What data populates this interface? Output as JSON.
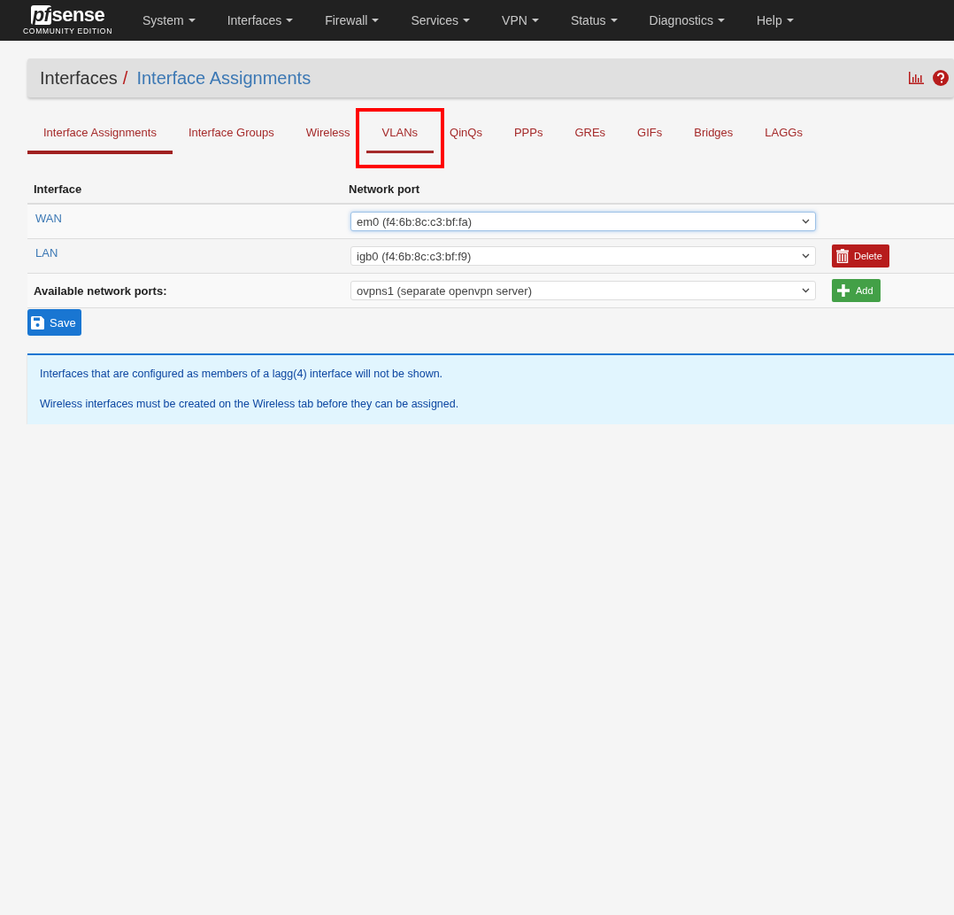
{
  "navbar": {
    "logo": {
      "wordmark_left": "pf",
      "wordmark_right": "sense",
      "edition": "COMMUNITY EDITION"
    },
    "menus": [
      {
        "label": "System"
      },
      {
        "label": "Interfaces"
      },
      {
        "label": "Firewall"
      },
      {
        "label": "Services"
      },
      {
        "label": "VPN"
      },
      {
        "label": "Status"
      },
      {
        "label": "Diagnostics"
      },
      {
        "label": "Help"
      }
    ]
  },
  "breadcrumb": {
    "parent": "Interfaces",
    "separator": "/",
    "current": "Interface Assignments"
  },
  "tabs": [
    {
      "label": "Interface Assignments",
      "selected": true,
      "hovered": false,
      "highlighted": false
    },
    {
      "label": "Interface Groups",
      "selected": false,
      "hovered": false,
      "highlighted": false
    },
    {
      "label": "Wireless",
      "selected": false,
      "hovered": false,
      "highlighted": false
    },
    {
      "label": "VLANs",
      "selected": false,
      "hovered": true,
      "highlighted": true
    },
    {
      "label": "QinQs",
      "selected": false,
      "hovered": false,
      "highlighted": false
    },
    {
      "label": "PPPs",
      "selected": false,
      "hovered": false,
      "highlighted": false
    },
    {
      "label": "GREs",
      "selected": false,
      "hovered": false,
      "highlighted": false
    },
    {
      "label": "GIFs",
      "selected": false,
      "hovered": false,
      "highlighted": false
    },
    {
      "label": "Bridges",
      "selected": false,
      "hovered": false,
      "highlighted": false
    },
    {
      "label": "LAGGs",
      "selected": false,
      "hovered": false,
      "highlighted": false
    }
  ],
  "table": {
    "columns": [
      "Interface",
      "Network port"
    ],
    "rows": [
      {
        "kind": "assigned",
        "interface": "WAN",
        "port": "em0 (f4:6b:8c:c3:bf:fa)",
        "focused": true
      },
      {
        "kind": "assigned",
        "interface": "LAN",
        "port": "igb0 (f4:6b:8c:c3:bf:f9)",
        "focused": false,
        "action": "Delete"
      },
      {
        "kind": "available",
        "interface": "Available network ports:",
        "port": "ovpns1 (separate openvpn server)",
        "focused": false,
        "action": "Add"
      }
    ]
  },
  "save_button": "Save",
  "info": [
    "Interfaces that are configured as members of a lagg(4) interface will not be shown.",
    "Wireless interfaces must be created on the Wireless tab before they can be assigned."
  ]
}
